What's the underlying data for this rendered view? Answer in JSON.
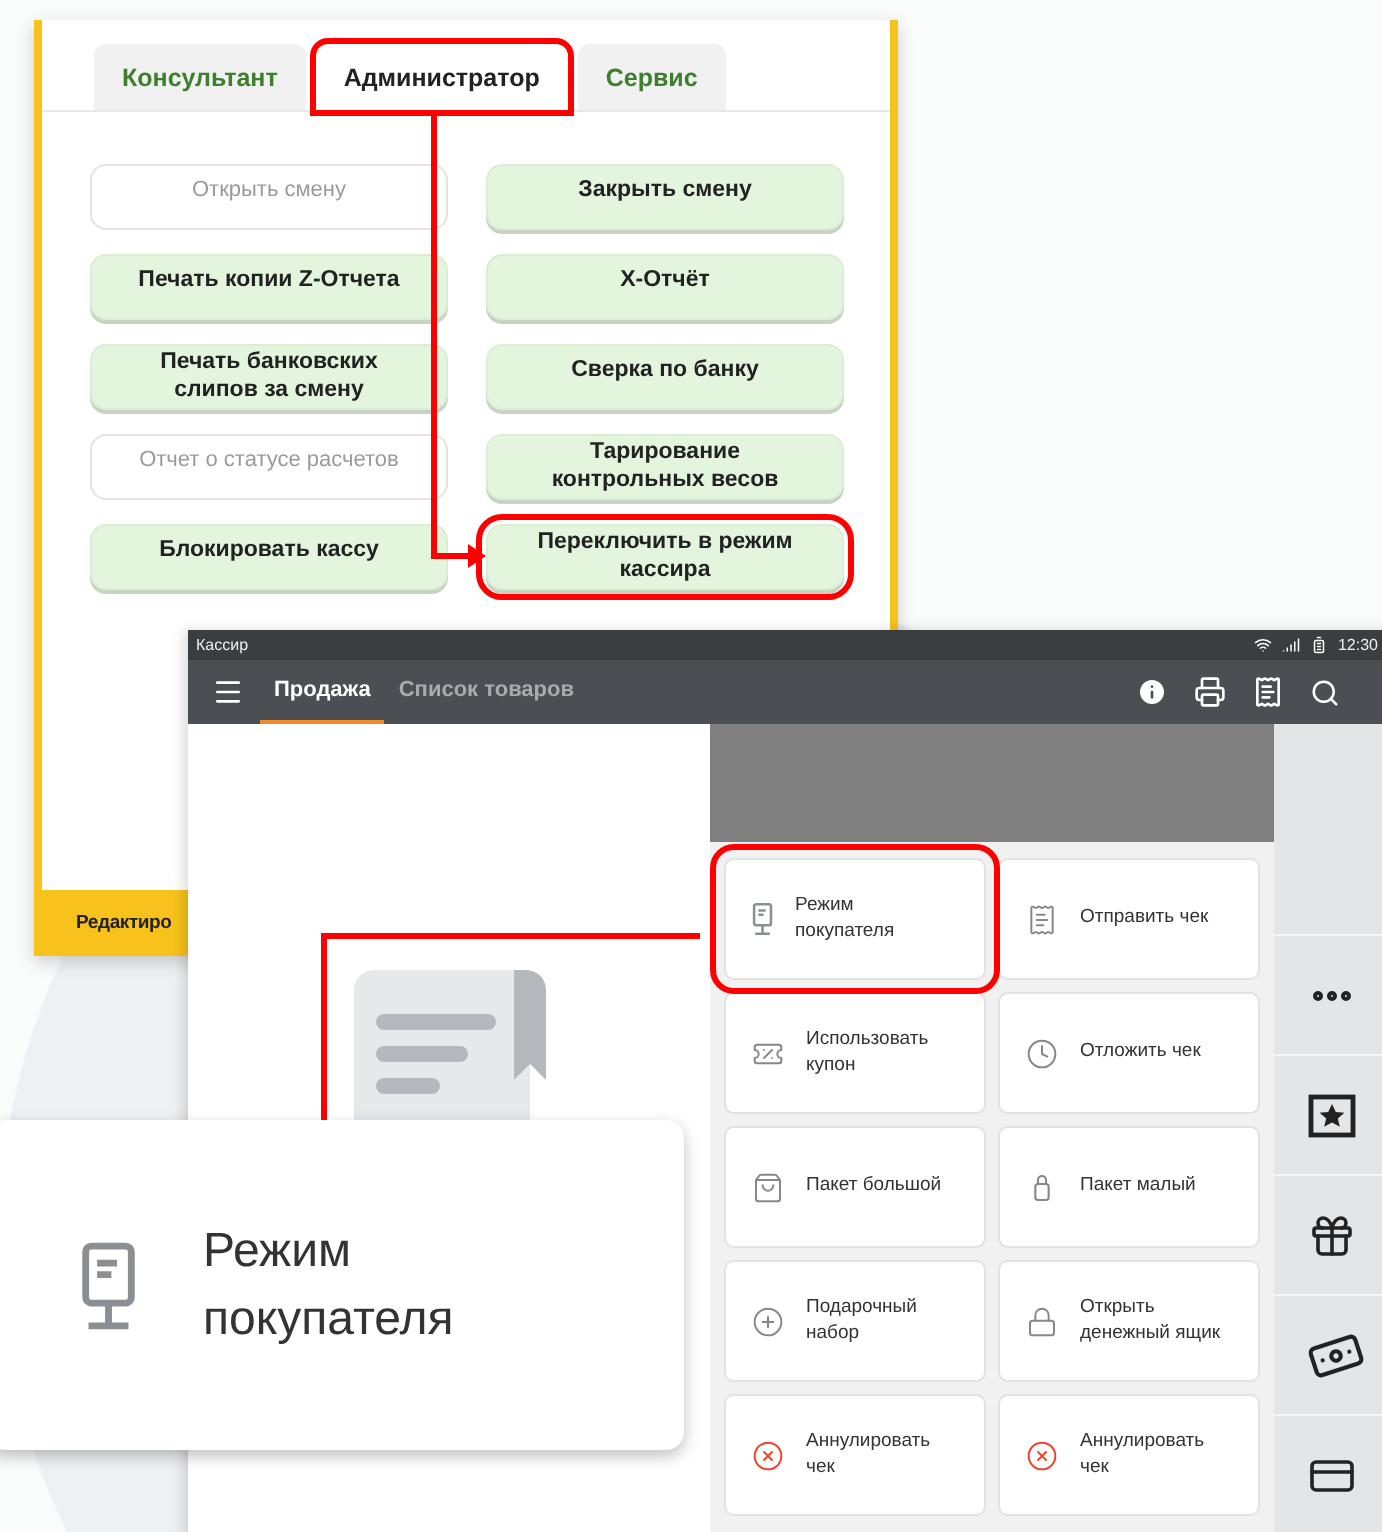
{
  "admin_panel": {
    "tabs": [
      {
        "label": "Консультант",
        "selected": false,
        "annotated": false
      },
      {
        "label": "Администратор",
        "selected": true,
        "annotated": true
      },
      {
        "label": "Сервис",
        "selected": false,
        "annotated": false
      }
    ],
    "buttons": [
      {
        "label": "Открыть смену",
        "disabled": true,
        "annotated": false
      },
      {
        "label": "Закрыть смену",
        "disabled": false,
        "annotated": false
      },
      {
        "label": "Печать копии Z-Отчета",
        "disabled": false,
        "annotated": false
      },
      {
        "label": "X-Отчёт",
        "disabled": false,
        "annotated": false
      },
      {
        "label": "Печать банковских\nслипов за смену",
        "disabled": false,
        "annotated": false
      },
      {
        "label": "Сверка по банку",
        "disabled": false,
        "annotated": false
      },
      {
        "label": "Отчет о статусе расчетов",
        "disabled": true,
        "annotated": false
      },
      {
        "label": "Тарирование\nконтрольных весов",
        "disabled": false,
        "annotated": false
      },
      {
        "label": "Блокировать кассу",
        "disabled": false,
        "annotated": false
      },
      {
        "label": "Переключить в режим\nкассира",
        "disabled": false,
        "annotated": true
      }
    ],
    "footer": "Редактиро"
  },
  "cashier": {
    "status_bar": {
      "title": "Кассир",
      "time": "12:30"
    },
    "tabs": [
      {
        "label": "Продажа",
        "selected": true
      },
      {
        "label": "Список товаров",
        "selected": false
      }
    ],
    "actions": [
      {
        "label": "Режим\nпокупателя",
        "annotated": true
      },
      {
        "label": "Отправить чек",
        "annotated": false
      },
      {
        "label": "Использовать\nкупон",
        "annotated": false
      },
      {
        "label": "Отложить чек",
        "annotated": false
      },
      {
        "label": "Пакет большой",
        "annotated": false
      },
      {
        "label": "Пакет малый",
        "annotated": false
      },
      {
        "label": "Подарочный\nнабор",
        "annotated": false
      },
      {
        "label": "Открыть\nденежный ящик",
        "annotated": false
      },
      {
        "label": "Аннулировать\nчек",
        "annotated": false
      },
      {
        "label": "Аннулировать\nчек",
        "annotated": false
      }
    ],
    "side_tiles": [
      {
        "kind": "empty"
      },
      {
        "kind": "more"
      },
      {
        "kind": "star-card"
      },
      {
        "kind": "gift"
      },
      {
        "kind": "money"
      },
      {
        "kind": "card"
      }
    ]
  },
  "zoom_card": {
    "label": "Режим\nпокупателя"
  }
}
